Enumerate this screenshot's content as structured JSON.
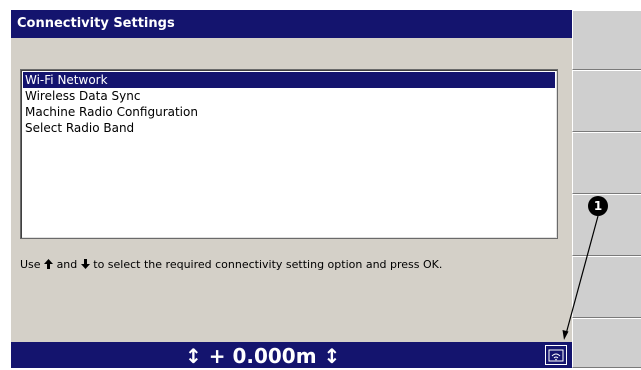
{
  "window": {
    "title": "Connectivity Settings"
  },
  "list": {
    "items": [
      {
        "label": "Wi-Fi Network",
        "selected": true
      },
      {
        "label": "Wireless Data Sync",
        "selected": false
      },
      {
        "label": "Machine Radio Configuration",
        "selected": false
      },
      {
        "label": "Select Radio Band",
        "selected": false
      }
    ]
  },
  "instruction": {
    "prefix": "Use",
    "up_arrow": "🡅",
    "middle": "and",
    "down_arrow": "🡇",
    "suffix": "to select the required connectivity setting option and press OK."
  },
  "status_bar": {
    "value_text": "↕ + 0.000m ↕",
    "icon": "radio-icon"
  },
  "callout": {
    "number": "1"
  },
  "colors": {
    "title_bar": "#14146e",
    "panel": "#d4d0c8",
    "selection": "#14146e",
    "softkey": "#cfcfcf"
  }
}
